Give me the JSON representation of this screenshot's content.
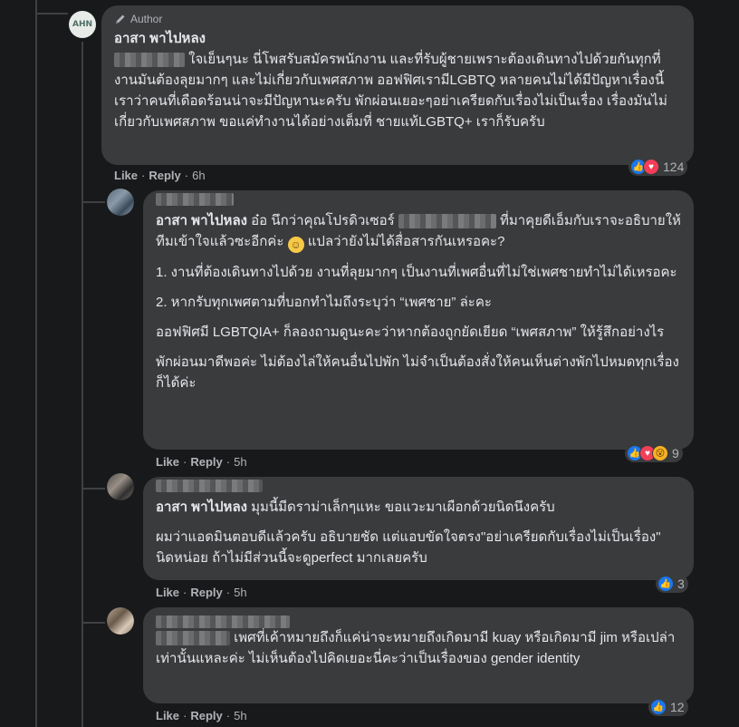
{
  "comments": [
    {
      "badge": "Author",
      "name": "อาสา พาไปหลง",
      "avatar_text": "AHN",
      "text": "ใจเย็นๆนะ นี่โพสรับสมัครพนักงาน และที่รับผู้ชายเพราะต้องเดินทางไปด้วยกันทุกที่งานมันต้องลุยมากๆ และไม่เกี่ยวกับเพศสภาพ ออฟฟิศเรามีLGBTQ หลายคนไม่ได้มีปัญหาเรื่องนี้ เราว่าคนที่เดือดร้อนน่าจะมีปัญหานะครับ พักผ่อนเยอะๆอย่าเครียดกับเรื่องไม่เป็นเรื่อง เรื่องมันไม่เกี่ยวกับเพศสภาพ ขอแค่ทำงานได้อย่างเต็มที่ ชายแท้LGBTQ+ เราก็รับครับ",
      "like": "Like",
      "reply": "Reply",
      "time": "6h",
      "reaction_count": "124"
    },
    {
      "mention": "อาสา พาไปหลง",
      "text_p1": "อ๋อ นึกว่าคุณโปรดิวเซอร์",
      "text_p1b": "ที่มาคุยดีเอ็มกับเราจะอธิบายให้ทีมเข้าใจแล้วซะอีกค่ะ",
      "text_p1c": "แปลว่ายังไม่ได้สื่อสารกันเหรอคะ?",
      "p2": "1. งานที่ต้องเดินทางไปด้วย งานที่ลุยมากๆ เป็นงานที่เพศอื่นที่ไม่ใช่เพศชายทำไม่ได้เหรอคะ",
      "p3": "2. หากรับทุกเพศตามที่บอกทำไมถึงระบุว่า “เพศชาย” ล่ะคะ",
      "p4": "ออฟฟิศมี LGBTQIA+ ก็ลองถามดูนะคะว่าหากต้องถูกยัดเยียด “เพศสภาพ” ให้รู้สึกอย่างไร",
      "p5": "พักผ่อนมาดีพอค่ะ ไม่ต้องไล่ให้คนอื่นไปพัก ไม่จำเป็นต้องสั่งให้คนเห็นต่างพักไปหมดทุกเรื่องก็ได้ค่ะ",
      "like": "Like",
      "reply": "Reply",
      "time": "5h",
      "reaction_count": "9"
    },
    {
      "mention": "อาสา พาไปหลง",
      "text_p1": "มุมนี้มีดราม่าเล็กๆแหะ ขอแวะมาเผือกด้วยนิดนึงครับ",
      "p2": "ผมว่าแอดมินตอบดีแล้วครับ อธิบายชัด แต่แอบขัดใจตรง\"อย่าเครียดกับเรื่องไม่เป็นเรื่อง\" นิดหน่อย ถ้าไม่มีส่วนนี้จะดูperfect มากเลยครับ",
      "like": "Like",
      "reply": "Reply",
      "time": "5h",
      "reaction_count": "3"
    },
    {
      "text": "เพศที่เค้าหมายถึงก็แค่น่าจะหมายถึงเกิดมามี kuay หรือเกิดมามี jim หรือเปล่าเท่านั้นแหละค่ะ ไม่เห็นต้องไปคิดเยอะนี่คะว่าเป็นเรื่องของ gender identity",
      "like": "Like",
      "reply": "Reply",
      "time": "5h",
      "reaction_count": "12"
    }
  ]
}
